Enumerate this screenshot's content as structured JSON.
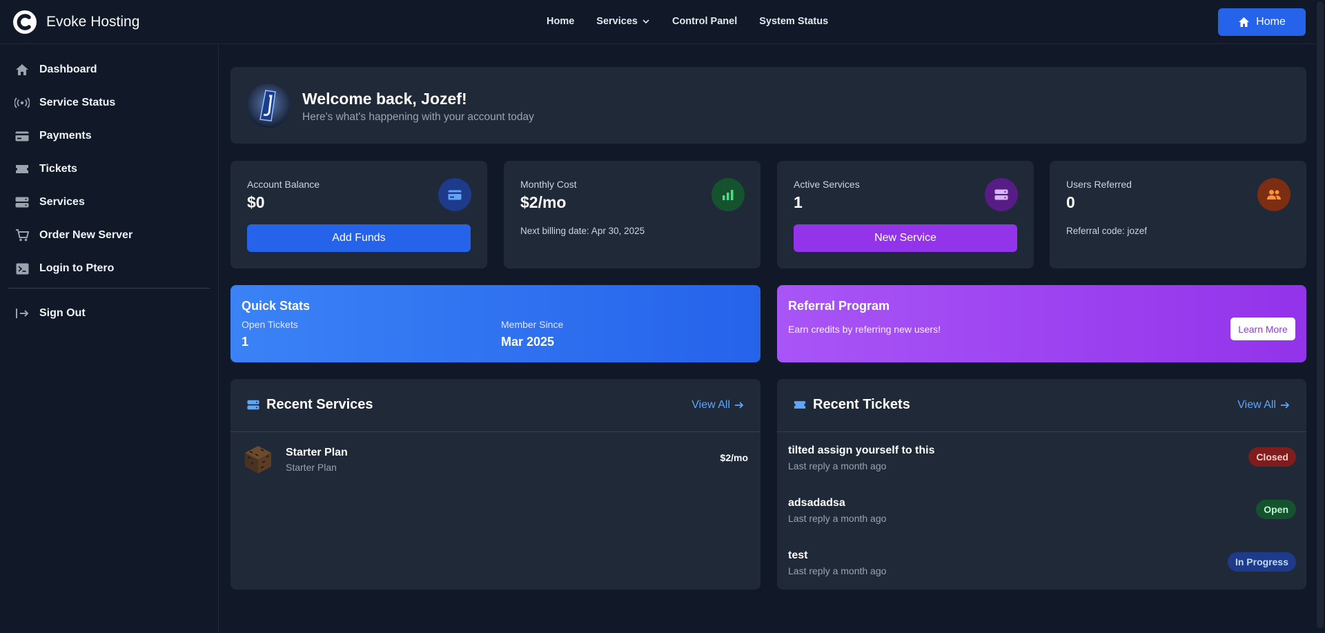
{
  "brand": {
    "name": "Evoke Hosting"
  },
  "nav": {
    "links": [
      "Home",
      "Services",
      "Control Panel",
      "System Status"
    ],
    "home_button": "Home"
  },
  "sidebar": {
    "items": [
      {
        "label": "Dashboard",
        "icon": "home-icon"
      },
      {
        "label": "Service Status",
        "icon": "broadcast-icon"
      },
      {
        "label": "Payments",
        "icon": "credit-card-icon"
      },
      {
        "label": "Tickets",
        "icon": "ticket-icon"
      },
      {
        "label": "Services",
        "icon": "server-icon"
      },
      {
        "label": "Order New Server",
        "icon": "cart-icon"
      },
      {
        "label": "Login to Ptero",
        "icon": "terminal-icon"
      }
    ],
    "sign_out": "Sign Out"
  },
  "welcome": {
    "title": "Welcome back, Jozef!",
    "subtitle": "Here's what's happening with your account today"
  },
  "stats": {
    "balance": {
      "label": "Account Balance",
      "value": "$0",
      "button": "Add Funds"
    },
    "monthly": {
      "label": "Monthly Cost",
      "value": "$2/mo",
      "note": "Next billing date: Apr 30, 2025"
    },
    "active": {
      "label": "Active Services",
      "value": "1",
      "button": "New Service"
    },
    "referred": {
      "label": "Users Referred",
      "value": "0",
      "note": "Referral code: jozef"
    }
  },
  "quick_stats": {
    "title": "Quick Stats",
    "open_tickets_label": "Open Tickets",
    "open_tickets_value": "1",
    "member_since_label": "Member Since",
    "member_since_value": "Mar 2025"
  },
  "referral": {
    "title": "Referral Program",
    "subtitle": "Earn credits by referring new users!",
    "button": "Learn More"
  },
  "recent_services": {
    "title": "Recent Services",
    "view_all": "View All",
    "items": [
      {
        "name": "Starter Plan",
        "plan": "Starter Plan",
        "price": "$2/mo"
      }
    ]
  },
  "recent_tickets": {
    "title": "Recent Tickets",
    "view_all": "View All",
    "items": [
      {
        "title": "tilted assign yourself to this",
        "sub": "Last reply a month ago",
        "status": "Closed"
      },
      {
        "title": "adsadadsa",
        "sub": "Last reply a month ago",
        "status": "Open"
      },
      {
        "title": "test",
        "sub": "Last reply a month ago",
        "status": "In Progress"
      }
    ]
  },
  "colors": {
    "closed_bg": "#7f1d1d",
    "closed_fg": "#fecaca",
    "open_bg": "#14532d",
    "open_fg": "#bbf7d0",
    "progress_bg": "#1e3a8a",
    "progress_fg": "#bfdbfe"
  }
}
